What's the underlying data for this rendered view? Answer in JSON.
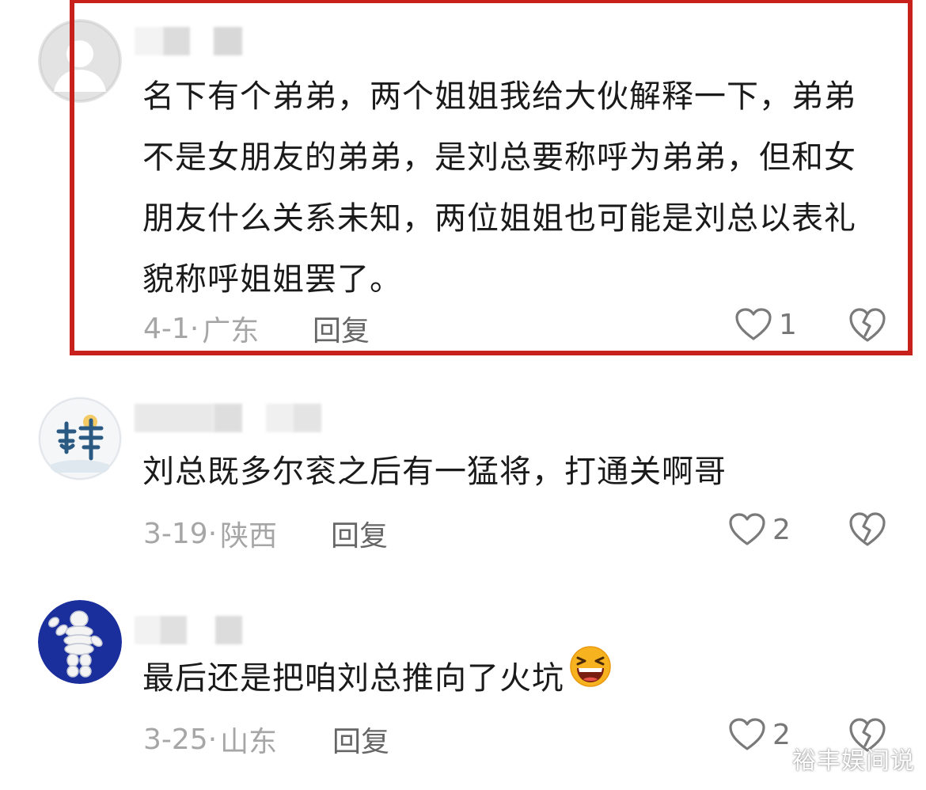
{
  "comments": [
    {
      "text": "名下有个弟弟，两个姐姐我给大伙解释一下，弟弟不是女朋友的弟弟，是刘总要称呼为弟弟，但和女朋友什么关系未知，两位姐姐也可能是刘总以表礼貌称呼姐姐罢了。",
      "date": "4-1",
      "dot": "·",
      "region": "广东",
      "reply_label": "回复",
      "likes": "1",
      "avatar": "default-avatar-icon"
    },
    {
      "text": "刘总既多尔衮之后有一猛将，打通关啊哥",
      "date": "3-19",
      "dot": "·",
      "region": "陕西",
      "reply_label": "回复",
      "likes": "2",
      "avatar": "calligraphy-logo-avatar"
    },
    {
      "text": "最后还是把咱刘总推向了火坑",
      "date": "3-25",
      "dot": "·",
      "region": "山东",
      "reply_label": "回复",
      "likes": "2",
      "avatar": "michelin-man-avatar",
      "emoji": "laughing-squint-emoji"
    }
  ],
  "watermark": "裕丰娱间说",
  "colors": {
    "highlight_border": "#c8201a",
    "meta_text": "#a6a6a6",
    "reply_text": "#666666"
  }
}
